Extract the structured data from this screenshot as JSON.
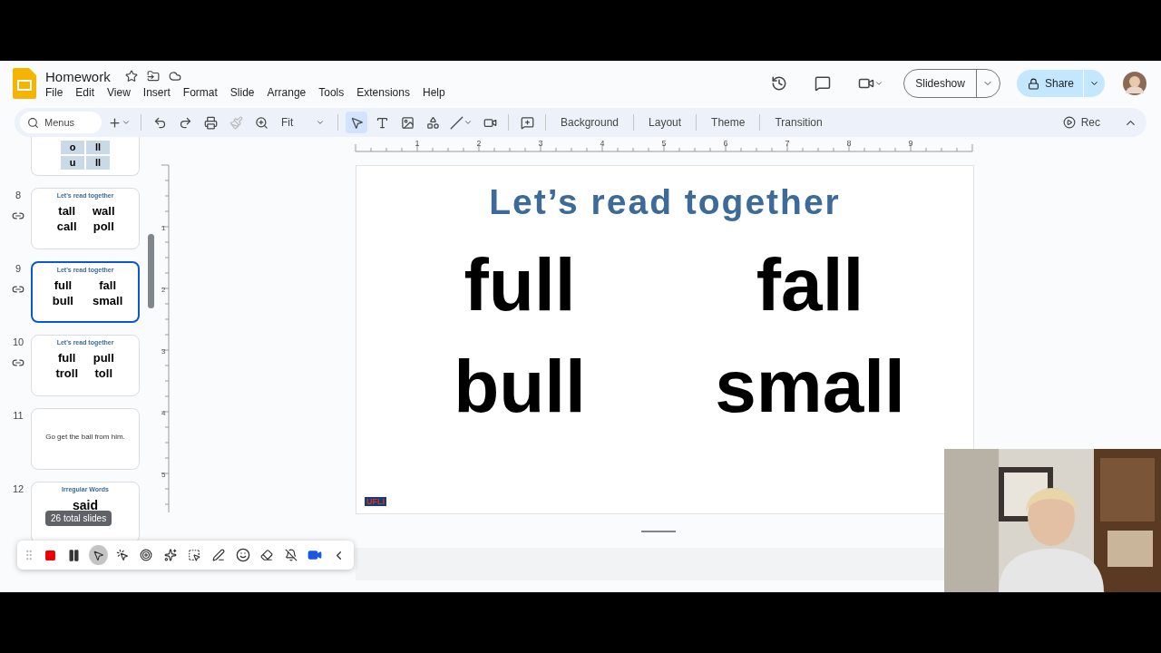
{
  "document": {
    "title": "Homework"
  },
  "menu": [
    "File",
    "Edit",
    "View",
    "Insert",
    "Format",
    "Slide",
    "Arrange",
    "Tools",
    "Extensions",
    "Help"
  ],
  "header_buttons": {
    "slideshow": "Slideshow",
    "share": "Share"
  },
  "toolbar": {
    "search_placeholder": "Menus",
    "zoom": "Fit",
    "actions": [
      "Background",
      "Layout",
      "Theme",
      "Transition"
    ],
    "rec": "Rec"
  },
  "filmstrip": {
    "slides": [
      {
        "kind": "letters",
        "partial": true,
        "selected": false,
        "linked": false,
        "cells": [
          "o",
          "ll",
          "u",
          "ll"
        ]
      },
      {
        "number": "8",
        "kind": "words",
        "partial": false,
        "selected": false,
        "linked": true,
        "title": "Let's read together",
        "words": [
          "tall",
          "wall",
          "call",
          "poll"
        ]
      },
      {
        "number": "9",
        "kind": "words",
        "partial": false,
        "selected": true,
        "linked": true,
        "title": "Let's read together",
        "words": [
          "full",
          "fall",
          "bull",
          "small"
        ]
      },
      {
        "number": "10",
        "kind": "words",
        "partial": false,
        "selected": false,
        "linked": true,
        "title": "Let's read together",
        "words": [
          "full",
          "pull",
          "troll",
          "toll"
        ]
      },
      {
        "number": "11",
        "kind": "sentence",
        "partial": false,
        "selected": false,
        "linked": false,
        "text": "Go get the ball from him."
      },
      {
        "number": "12",
        "kind": "single",
        "partial": false,
        "selected": false,
        "linked": false,
        "title": "Irregular Words",
        "words": [
          "said"
        ]
      }
    ],
    "tooltip": "26 total slides"
  },
  "rulers": {
    "horizontal": [
      "1",
      "2",
      "3",
      "4",
      "5",
      "6",
      "7",
      "8",
      "9"
    ],
    "vertical": [
      "1",
      "2",
      "3",
      "4",
      "5"
    ]
  },
  "slide": {
    "title": "Let’s read together",
    "words": [
      "full",
      "fall",
      "bull",
      "small"
    ],
    "logo_text": "UFLI"
  }
}
